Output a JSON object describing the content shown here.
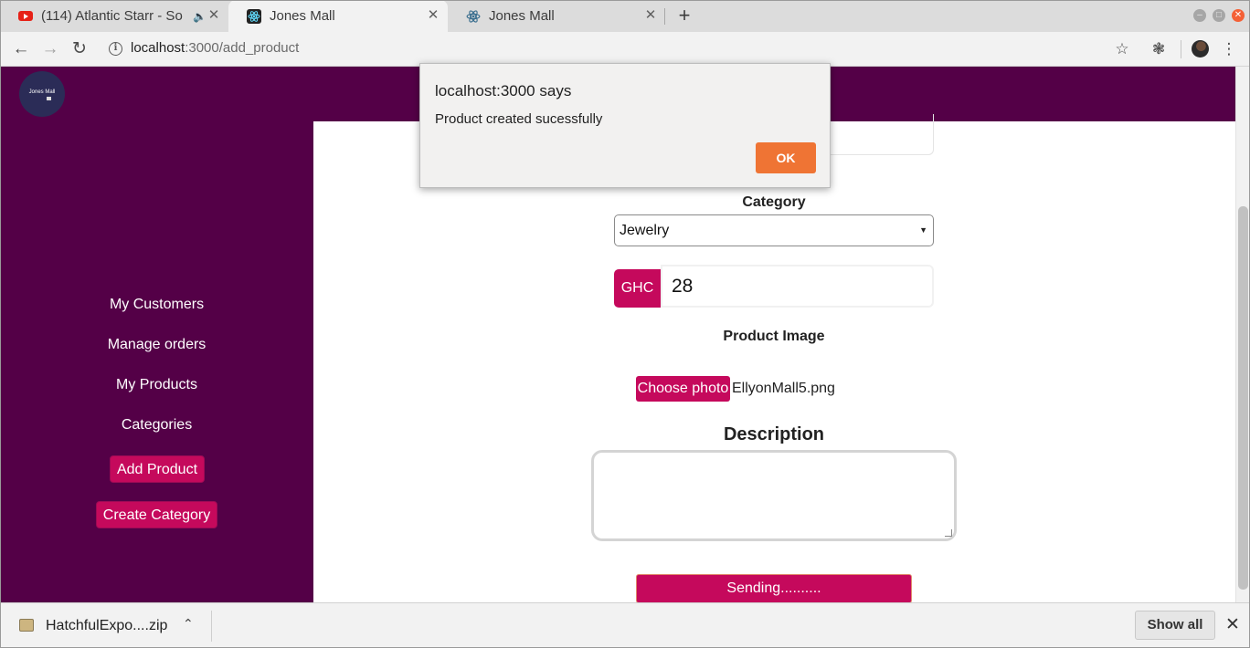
{
  "browser": {
    "tabs": [
      {
        "title": "(114) Atlantic Starr - So",
        "favicon": "youtube-icon",
        "audio": "speaker-icon"
      },
      {
        "title": "Jones Mall",
        "favicon": "react-icon"
      },
      {
        "title": "Jones Mall",
        "favicon": "react-icon"
      }
    ],
    "active_tab": 1,
    "new_tab_glyph": "+",
    "url_host": "localhost",
    "url_path": ":3000/add_product"
  },
  "app": {
    "logo_text": "Jones Mall",
    "sidebar": {
      "links": [
        "My Customers",
        "Manage orders",
        "My Products",
        "Categories"
      ],
      "add_product": "Add Product",
      "create_category": "Create Category"
    },
    "form": {
      "category_label": "Category",
      "category_value": "Jewelry",
      "currency": "GHC",
      "price_value": "28",
      "image_label": "Product Image",
      "choose_photo": "Choose photo",
      "file_name": "EllyonMall5.png",
      "description_label": "Description",
      "description_value": "",
      "submit_label": "Sending.........."
    }
  },
  "alert": {
    "title": "localhost:3000 says",
    "message": "Product created sucessfully",
    "ok_label": "OK"
  },
  "download_bar": {
    "file_name": "HatchfulExpo....zip",
    "show_all": "Show all"
  },
  "colors": {
    "brand": "#540047",
    "accent": "#c5095c",
    "dialog_button": "#ef7434"
  }
}
